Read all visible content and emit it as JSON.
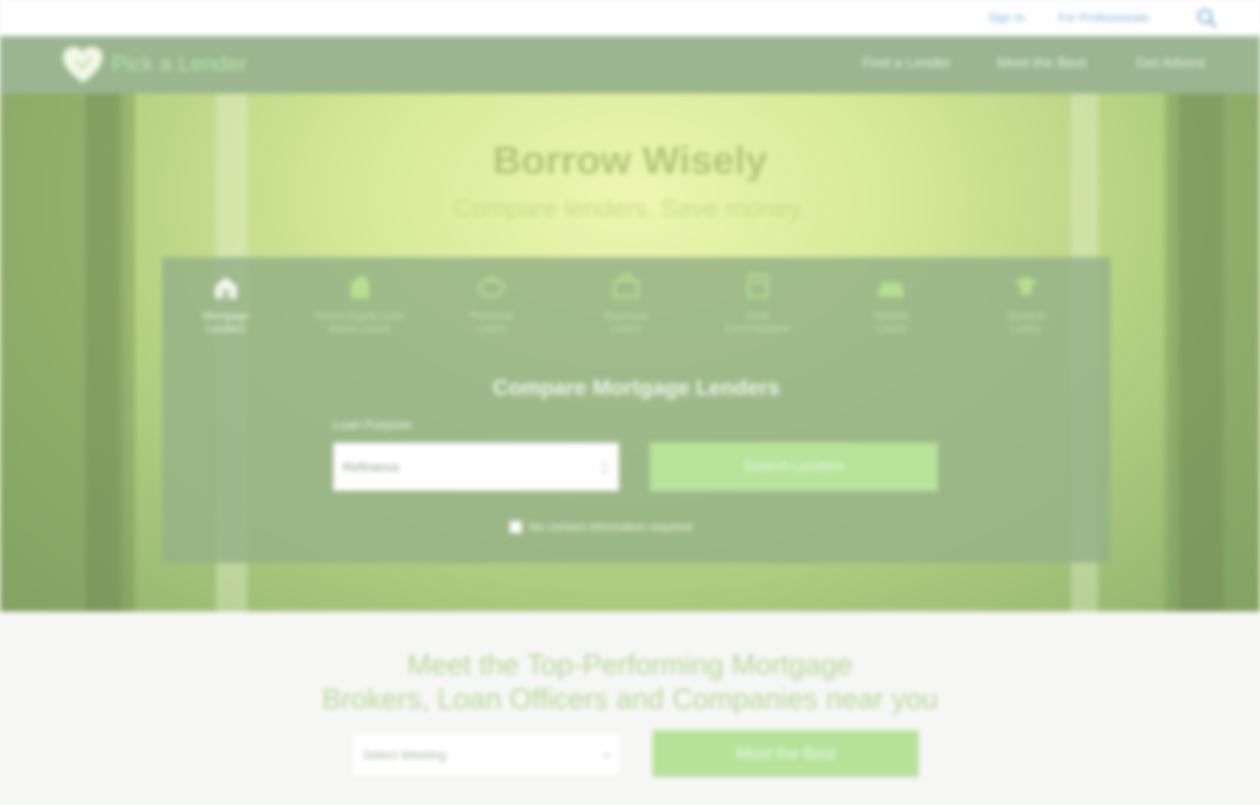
{
  "colors": {
    "nav_bg": "#9ab590",
    "accent_green": "#b7e39a",
    "brand_text": "#bfe6a6",
    "utility_link": "#7fb4d6",
    "panel_bg": "#96b287"
  },
  "utility_nav": {
    "sign_in": "Sign In",
    "for_professionals": "For Professionals",
    "search_icon": "search-icon"
  },
  "header": {
    "brand": "Pick a Lender",
    "logo_icon": "heart-shield-icon",
    "nav": [
      {
        "label": "Find a Lender"
      },
      {
        "label": "Meet the Best"
      },
      {
        "label": "Get Advice"
      }
    ]
  },
  "hero": {
    "title": "Borrow Wisely",
    "subtitle": "Compare lenders. Save money."
  },
  "loan_types": [
    {
      "label_line1": "Mortgage",
      "label_line2": "Lenders",
      "icon": "house-icon",
      "active": true
    },
    {
      "label_line1": "Home Equity Line/",
      "label_line2": "Home Loans",
      "icon": "building-icon",
      "active": false
    },
    {
      "label_line1": "Personal",
      "label_line2": "Loans",
      "icon": "piggy-bank-icon",
      "active": false
    },
    {
      "label_line1": "Business",
      "label_line2": "Loans",
      "icon": "briefcase-icon",
      "active": false
    },
    {
      "label_line1": "Debt",
      "label_line2": "Consolidation",
      "icon": "chart-icon",
      "active": false
    },
    {
      "label_line1": "Vehicle",
      "label_line2": "Loans",
      "icon": "car-icon",
      "active": false
    },
    {
      "label_line1": "Student",
      "label_line2": "Loans",
      "icon": "graduation-icon",
      "active": false
    }
  ],
  "compare": {
    "title": "Compare Mortgage Lenders",
    "field_label": "Loan Purpose",
    "selected_value": "Refinance",
    "search_button": "Search Lenders",
    "checkbox_label": "No contact information required"
  },
  "meet": {
    "title_line1": "Meet the Top-Performing Mortgage",
    "title_line2": "Brokers, Loan Officers and Companies near you",
    "select_placeholder": "Select Meeting",
    "button": "Meet the Best"
  }
}
